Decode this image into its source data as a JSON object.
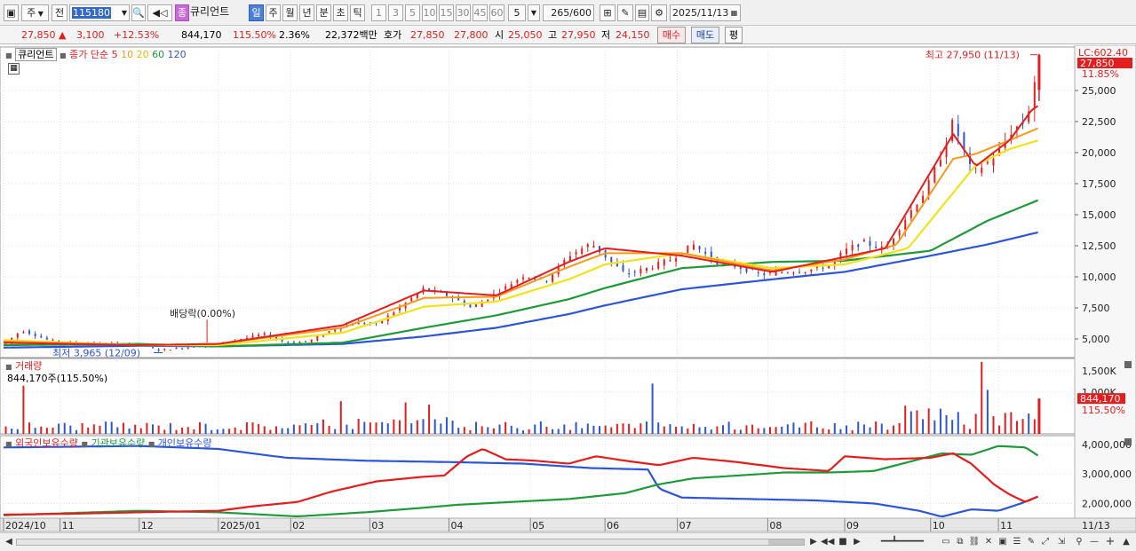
{
  "toolbar": {
    "period_select": "주",
    "jeon_label": "전",
    "code_value": "115180",
    "stock_icon_label": "종",
    "stock_name": "큐리언트",
    "period_tabs": [
      "일",
      "주",
      "월",
      "년",
      "분",
      "초",
      "틱"
    ],
    "active_period": "일",
    "interval_buttons": [
      "1",
      "3",
      "5",
      "10",
      "15",
      "30",
      "45",
      "60"
    ],
    "count_select": "5",
    "count_value": "265",
    "count_max": "/600",
    "date_value": "2025/11/13"
  },
  "pricebar": {
    "price": "27,850",
    "change": "3,100",
    "change_pct": "+12.53%",
    "volume": "844,170",
    "volume_pct": "115.50%",
    "turnover_pct": "2.36%",
    "amount": "22,372백만",
    "hoga_label": "호가",
    "ask": "27,850",
    "bid": "27,800",
    "open_label": "시",
    "open": "25,050",
    "high_label": "고",
    "high": "27,950",
    "low_label": "저",
    "low": "24,150",
    "buy_label": "매수",
    "sell_label": "매도",
    "eval_label": "평"
  },
  "chart_data": [
    {
      "type": "candlestick",
      "legend": {
        "name": "큐리언트",
        "main": "종가 단순",
        "ma_periods": [
          "5",
          "10",
          "20",
          "60",
          "120"
        ],
        "ma_colors": [
          "#e41e1e",
          "#f59a1b",
          "#f2e21a",
          "#1f9a3a",
          "#2d55d8"
        ]
      },
      "y_ticks": [
        "25,000",
        "22,500",
        "20,000",
        "17,500",
        "15,000",
        "12,500",
        "10,000",
        "7,500",
        "5,000"
      ],
      "y_range": [
        3500,
        28500
      ],
      "current_label": "LC:602.40",
      "current_price": "27,850",
      "current_pct": "11.85%",
      "annotations": {
        "high": "최고 27,950 (11/13)",
        "low": "최저 3,965 (12/09)",
        "dividend": "배당락(0.00%)"
      },
      "x_labels": [
        {
          "label": "2024/10",
          "day": 0
        },
        {
          "label": "11",
          "day": 25
        },
        {
          "label": "12",
          "day": 60
        },
        {
          "label": "2025/01",
          "day": 95
        },
        {
          "label": "02",
          "day": 127
        },
        {
          "label": "03",
          "day": 162
        },
        {
          "label": "04",
          "day": 197
        },
        {
          "label": "05",
          "day": 233
        },
        {
          "label": "06",
          "day": 266
        },
        {
          "label": "07",
          "day": 298
        },
        {
          "label": "08",
          "day": 338
        },
        {
          "label": "09",
          "day": 372
        },
        {
          "label": "10",
          "day": 410
        },
        {
          "label": "11",
          "day": 440
        }
      ],
      "x_end_label": "11/13",
      "price_path": [
        [
          0,
          4600
        ],
        [
          8,
          5700
        ],
        [
          20,
          4900
        ],
        [
          30,
          4700
        ],
        [
          45,
          4600
        ],
        [
          60,
          4600
        ],
        [
          68,
          4100
        ],
        [
          80,
          4300
        ],
        [
          95,
          4600
        ],
        [
          115,
          5400
        ],
        [
          125,
          4700
        ],
        [
          135,
          4800
        ],
        [
          145,
          5700
        ],
        [
          155,
          6300
        ],
        [
          165,
          6200
        ],
        [
          175,
          7500
        ],
        [
          186,
          9100
        ],
        [
          198,
          8400
        ],
        [
          207,
          7500
        ],
        [
          218,
          8700
        ],
        [
          230,
          10100
        ],
        [
          240,
          9700
        ],
        [
          250,
          11700
        ],
        [
          260,
          12700
        ],
        [
          268,
          11300
        ],
        [
          275,
          10200
        ],
        [
          285,
          10700
        ],
        [
          295,
          11400
        ],
        [
          305,
          12600
        ],
        [
          315,
          11200
        ],
        [
          325,
          10800
        ],
        [
          335,
          10200
        ],
        [
          345,
          10400
        ],
        [
          355,
          10500
        ],
        [
          365,
          10900
        ],
        [
          372,
          12100
        ],
        [
          380,
          12800
        ],
        [
          390,
          12200
        ],
        [
          398,
          14500
        ],
        [
          408,
          17000
        ],
        [
          414,
          19500
        ],
        [
          420,
          22500
        ],
        [
          428,
          18500
        ],
        [
          434,
          19000
        ],
        [
          440,
          20000
        ],
        [
          446,
          21800
        ],
        [
          452,
          22500
        ],
        [
          455,
          24700
        ],
        [
          458,
          27850
        ]
      ],
      "ma5_path": [
        [
          0,
          4700
        ],
        [
          60,
          4500
        ],
        [
          95,
          4600
        ],
        [
          150,
          6100
        ],
        [
          186,
          8900
        ],
        [
          218,
          8500
        ],
        [
          250,
          11200
        ],
        [
          266,
          12300
        ],
        [
          300,
          11700
        ],
        [
          340,
          10400
        ],
        [
          372,
          11600
        ],
        [
          390,
          12300
        ],
        [
          420,
          21500
        ],
        [
          430,
          18900
        ],
        [
          445,
          21000
        ],
        [
          455,
          23500
        ],
        [
          458,
          23800
        ]
      ],
      "ma10_path": [
        [
          0,
          4800
        ],
        [
          60,
          4500
        ],
        [
          95,
          4600
        ],
        [
          150,
          5900
        ],
        [
          186,
          8300
        ],
        [
          218,
          8400
        ],
        [
          250,
          10800
        ],
        [
          266,
          11900
        ],
        [
          300,
          11900
        ],
        [
          340,
          10500
        ],
        [
          372,
          11400
        ],
        [
          395,
          12600
        ],
        [
          420,
          19500
        ],
        [
          430,
          19900
        ],
        [
          445,
          21000
        ],
        [
          458,
          22000
        ]
      ],
      "ma20_path": [
        [
          0,
          4900
        ],
        [
          60,
          4500
        ],
        [
          95,
          4500
        ],
        [
          150,
          5500
        ],
        [
          186,
          7600
        ],
        [
          218,
          8000
        ],
        [
          250,
          9800
        ],
        [
          266,
          11000
        ],
        [
          300,
          11900
        ],
        [
          340,
          10700
        ],
        [
          372,
          11000
        ],
        [
          400,
          12300
        ],
        [
          430,
          19000
        ],
        [
          445,
          20300
        ],
        [
          458,
          21000
        ]
      ],
      "ma60_path": [
        [
          0,
          4500
        ],
        [
          60,
          4600
        ],
        [
          95,
          4400
        ],
        [
          150,
          4700
        ],
        [
          186,
          5900
        ],
        [
          218,
          6900
        ],
        [
          250,
          8200
        ],
        [
          266,
          9100
        ],
        [
          300,
          10700
        ],
        [
          340,
          11200
        ],
        [
          372,
          11300
        ],
        [
          410,
          12100
        ],
        [
          435,
          14500
        ],
        [
          458,
          16200
        ]
      ],
      "ma120_path": [
        [
          0,
          4300
        ],
        [
          60,
          4450
        ],
        [
          95,
          4400
        ],
        [
          150,
          4600
        ],
        [
          186,
          5200
        ],
        [
          218,
          5900
        ],
        [
          250,
          7000
        ],
        [
          266,
          7700
        ],
        [
          300,
          9000
        ],
        [
          340,
          9800
        ],
        [
          372,
          10400
        ],
        [
          410,
          11700
        ],
        [
          435,
          12600
        ],
        [
          458,
          13600
        ]
      ]
    },
    {
      "type": "bar",
      "title": "거래량",
      "current_volume_label": "844,170주(115.50%)",
      "y_ticks": [
        "1,500K",
        "1,000K"
      ],
      "y_range": [
        0,
        1800
      ],
      "current_value": "844,170",
      "current_pct": "115.50%",
      "spikes": [
        [
          8,
          1150
        ],
        [
          148,
          780
        ],
        [
          178,
          750
        ],
        [
          188,
          700
        ],
        [
          286,
          1200
        ],
        [
          433,
          1720
        ],
        [
          435,
          1050
        ]
      ]
    },
    {
      "type": "line",
      "series_labels": [
        "외국인보유수량",
        "기관보유수량",
        "개인보유수량"
      ],
      "series_colors": [
        "#e41e1e",
        "#1f9a3a",
        "#2d55d8"
      ],
      "y_ticks": [
        "4,000,000",
        "3,000,000",
        "2,000,000"
      ],
      "y_range": [
        1500000,
        4300000
      ],
      "foreign_path": [
        [
          0,
          1620000
        ],
        [
          30,
          1650000
        ],
        [
          60,
          1700000
        ],
        [
          95,
          1750000
        ],
        [
          110,
          1900000
        ],
        [
          130,
          2050000
        ],
        [
          145,
          2400000
        ],
        [
          165,
          2750000
        ],
        [
          185,
          2900000
        ],
        [
          195,
          2950000
        ],
        [
          205,
          3600000
        ],
        [
          212,
          3850000
        ],
        [
          222,
          3500000
        ],
        [
          235,
          3450000
        ],
        [
          250,
          3350000
        ],
        [
          262,
          3600000
        ],
        [
          275,
          3450000
        ],
        [
          290,
          3300000
        ],
        [
          305,
          3550000
        ],
        [
          325,
          3400000
        ],
        [
          345,
          3200000
        ],
        [
          365,
          3100000
        ],
        [
          372,
          3600000
        ],
        [
          390,
          3500000
        ],
        [
          410,
          3550000
        ],
        [
          420,
          3700000
        ],
        [
          428,
          3350000
        ],
        [
          438,
          2650000
        ],
        [
          445,
          2300000
        ],
        [
          452,
          2050000
        ],
        [
          458,
          2250000
        ]
      ],
      "institution_path": [
        [
          0,
          1600000
        ],
        [
          60,
          1750000
        ],
        [
          95,
          1700000
        ],
        [
          130,
          1560000
        ],
        [
          160,
          1700000
        ],
        [
          185,
          1850000
        ],
        [
          200,
          1950000
        ],
        [
          225,
          2050000
        ],
        [
          250,
          2150000
        ],
        [
          275,
          2350000
        ],
        [
          290,
          2650000
        ],
        [
          305,
          2850000
        ],
        [
          325,
          2950000
        ],
        [
          345,
          3050000
        ],
        [
          365,
          3050000
        ],
        [
          385,
          3100000
        ],
        [
          400,
          3400000
        ],
        [
          415,
          3700000
        ],
        [
          428,
          3650000
        ],
        [
          440,
          3950000
        ],
        [
          452,
          3900000
        ],
        [
          458,
          3600000
        ]
      ],
      "individual_path": [
        [
          0,
          3900000
        ],
        [
          60,
          3950000
        ],
        [
          95,
          3850000
        ],
        [
          125,
          3550000
        ],
        [
          160,
          3450000
        ],
        [
          200,
          3400000
        ],
        [
          230,
          3350000
        ],
        [
          260,
          3200000
        ],
        [
          285,
          3150000
        ],
        [
          290,
          2500000
        ],
        [
          300,
          2200000
        ],
        [
          330,
          2150000
        ],
        [
          360,
          2100000
        ],
        [
          385,
          2000000
        ],
        [
          405,
          1750000
        ],
        [
          415,
          1550000
        ],
        [
          428,
          1800000
        ],
        [
          440,
          1750000
        ],
        [
          450,
          2000000
        ],
        [
          458,
          2250000
        ]
      ]
    }
  ],
  "bottombar": {
    "nav_left": "◀",
    "nav_right": "▶"
  }
}
